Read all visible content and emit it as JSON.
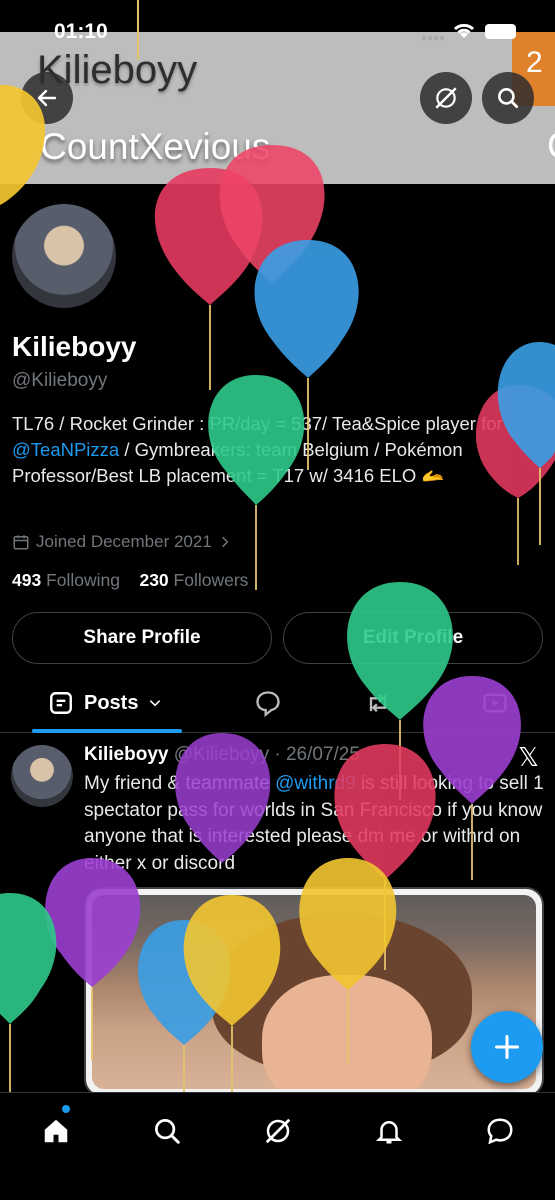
{
  "status_bar": {
    "time": "01:10"
  },
  "banner": {
    "line1": "Kilieboyy",
    "line2": "CountXevious",
    "badge": "2",
    "cut_letter": "C"
  },
  "profile": {
    "name": "Kilieboyy",
    "handle": "@Kilieboyy",
    "bio_part1": "TL76 / Rocket Grinder : PR/day = 537/ Tea&Spice player for ",
    "bio_link": "@TeaNPizza",
    "bio_part2": " / Gymbreakers: team Belgium / Pokémon Professor/Best LB placement = T17 w/ 3416 ELO ",
    "bio_emoji": "🫴",
    "joined": "Joined December 2021",
    "following_count": "493",
    "following_label": "Following",
    "followers_count": "230",
    "followers_label": "Followers"
  },
  "buttons": {
    "share": "Share Profile",
    "edit": "Edit Profile"
  },
  "tabs": {
    "posts": "Posts"
  },
  "post": {
    "author": "Kilieboyy",
    "handle_date": "@Kilieboyy · 26/07/25",
    "text_part1": "My friend & teammate ",
    "text_link": "@withrd9",
    "text_part2": " is still looking to sell 1 spectator pass for worlds in San Francisco if you know anyone that is interested please dm me or withrd on either x or discord",
    "x_logo": "𝕏"
  },
  "colors": {
    "accent": "#1d9bf0",
    "background": "#000000",
    "muted": "#71767b"
  },
  "icons": [
    "back-arrow-icon",
    "grok-icon",
    "search-icon",
    "calendar-icon",
    "chevron-right-icon",
    "chevron-down-icon",
    "reply-icon",
    "retweet-icon",
    "media-icon",
    "plus-icon",
    "home-icon",
    "notifications-icon",
    "messages-icon"
  ]
}
